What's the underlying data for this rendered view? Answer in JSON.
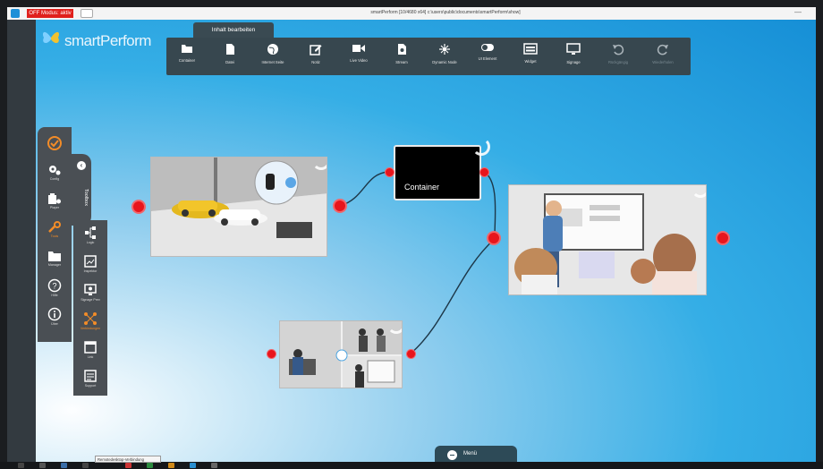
{
  "window": {
    "badge_label": "OFF Modus: aktiv",
    "title": "smartPerform [10/4680 x64] c:\\users\\public\\documents\\smartPerform\\show]",
    "minimize": "—"
  },
  "brand": {
    "logo_text": "smartPerform"
  },
  "toolbar": {
    "tab_label": "Inhalt bearbeiten",
    "tools": [
      {
        "label": "Container",
        "icon": "folder-icon"
      },
      {
        "label": "Datei",
        "icon": "file-icon"
      },
      {
        "label": "Internet Seite",
        "icon": "globe-icon"
      },
      {
        "label": "Notiz",
        "icon": "edit-icon"
      },
      {
        "label": "Live Video",
        "icon": "video-camera-icon"
      },
      {
        "label": "Stream",
        "icon": "stream-icon"
      },
      {
        "label": "Dynamic Node",
        "icon": "dynamic-node-icon"
      },
      {
        "label": "UI Element",
        "icon": "toggle-icon"
      },
      {
        "label": "Widget",
        "icon": "widget-icon"
      },
      {
        "label": "Signage",
        "icon": "monitor-icon"
      },
      {
        "label": "Rückgängig",
        "icon": "undo-icon"
      },
      {
        "label": "Wiederholen",
        "icon": "redo-icon"
      }
    ]
  },
  "left_panel": {
    "items": [
      {
        "label": "",
        "icon": "check-badge-icon"
      },
      {
        "label": "Config",
        "icon": "gears-icon"
      },
      {
        "label": "Player",
        "icon": "player-icon"
      },
      {
        "label": "Tools",
        "icon": "wrench-icon"
      },
      {
        "label": "Manager",
        "icon": "folder-icon"
      },
      {
        "label": "Hilfe",
        "icon": "help-icon"
      },
      {
        "label": "Über",
        "icon": "info-icon"
      }
    ]
  },
  "toolbox": {
    "label": "Toolbox",
    "close": "‹",
    "items": [
      {
        "label": "Logic",
        "icon": "logic-icon"
      },
      {
        "label": "Inspektor",
        "icon": "inspector-icon"
      },
      {
        "label": "Signage Prev",
        "icon": "signage-preview-icon"
      },
      {
        "label": "Verbindungen",
        "icon": "connections-icon"
      },
      {
        "label": "Link",
        "icon": "link-icon"
      },
      {
        "label": "Support",
        "icon": "support-icon"
      }
    ]
  },
  "nodes": {
    "container_label": "Container"
  },
  "menu": {
    "label": "Menü"
  },
  "taskbar": {
    "tooltip": "Remotedesktop-Verbindung"
  },
  "colors": {
    "port": "#e8151c",
    "toolbar": "#37474f",
    "panel": "#4a4f54",
    "accent": "#f28c28"
  }
}
